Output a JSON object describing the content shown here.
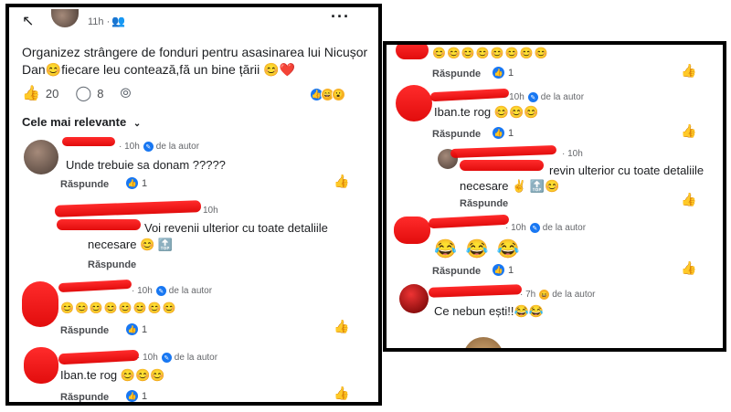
{
  "post": {
    "time": "11h ·",
    "text": "Organizez strângere de fonduri pentru asasinarea lui Nicușor Dan😊fiecare leu contează,fă un bine țării 😊❤️",
    "likes": "20",
    "comments": "8",
    "sort_label": "Cele mai relevante",
    "reaction_emojis": [
      "👍",
      "😄",
      "😮"
    ]
  },
  "labels": {
    "reply": "Răspunde",
    "author_tag": "de la autor"
  },
  "left_comments": [
    {
      "time": "10h",
      "text": "Unde trebuie sa donam ?????",
      "likes": "1"
    },
    {
      "time": "10h",
      "text": "Voi revenii ulterior cu toate detaliile",
      "text2": "necesare 😊 🔝",
      "likes": ""
    },
    {
      "time": "10h",
      "text": "😊😊😊😊😊😊😊😊",
      "likes": "1"
    },
    {
      "time": "10h",
      "text": "Iban.te rog 😊😊😊",
      "likes": "1"
    }
  ],
  "right_comments": [
    {
      "time": "",
      "text": "😊😊😊😊😊😊😊😊",
      "likes": "1"
    },
    {
      "time": "10h",
      "text": "Iban.te rog 😊😊😊",
      "likes": "1"
    },
    {
      "time": "10h",
      "text": "revin ulterior cu toate detaliile",
      "text2": "necesare ✌️ 🔝😊",
      "likes": ""
    },
    {
      "time": "10h",
      "text": "😂 😂 😂",
      "likes": "1"
    },
    {
      "time": "7h",
      "text": "Ce nebun ești!!😂😂",
      "likes": ""
    }
  ],
  "colors": {
    "accent": "#1877f2",
    "redact": "#ff1a1a"
  }
}
